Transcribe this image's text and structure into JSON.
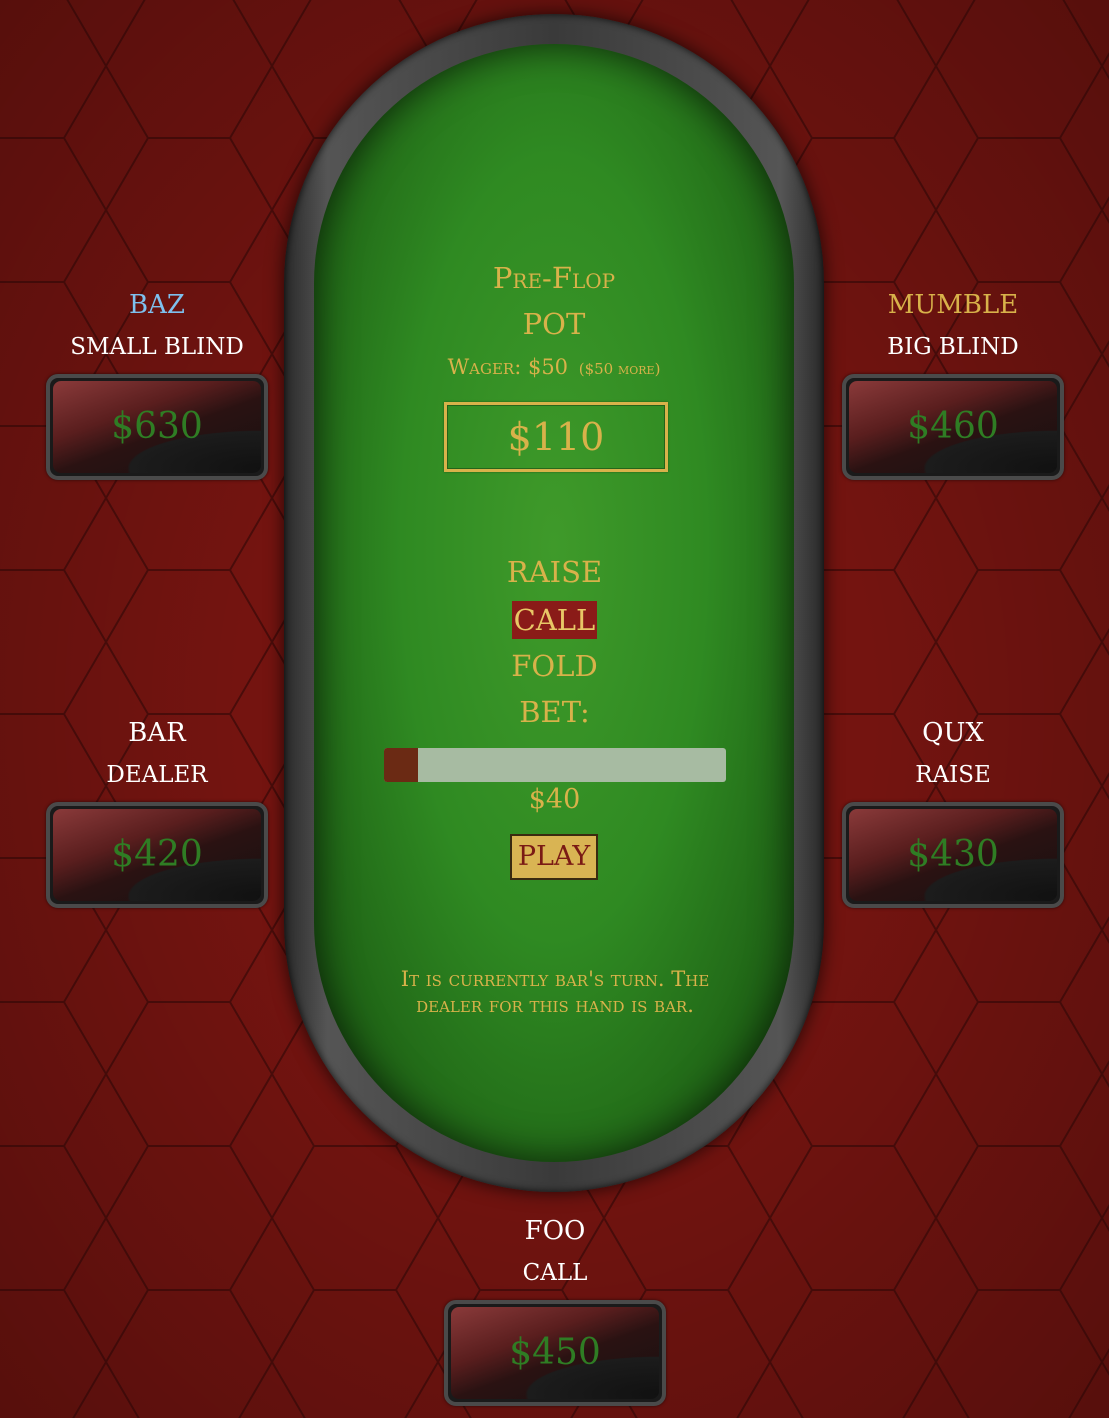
{
  "table": {
    "round": "Pre-Flop",
    "pot_label": "POT",
    "wager_label": "Wager: $50",
    "wager_more": "($50 more)",
    "pot_amount": "$110"
  },
  "actions": {
    "raise": "RAISE",
    "call": "CALL",
    "fold": "FOLD",
    "bet_label": "BET:",
    "selected": "call"
  },
  "bet": {
    "fraction": 0.1,
    "value": "$40"
  },
  "play_label": "PLAY",
  "status": "It is currently bar's turn. The dealer for this hand is bar.",
  "players": {
    "baz": {
      "name": "BAZ",
      "role": "SMALL BLIND",
      "chips": "$630",
      "name_color": "#7ec0ee"
    },
    "mumble": {
      "name": "MUMBLE",
      "role": "BIG BLIND",
      "chips": "$460",
      "name_color": "#d8b24a"
    },
    "bar": {
      "name": "BAR",
      "role": "DEALER",
      "chips": "$420",
      "name_color": "#ffffff"
    },
    "qux": {
      "name": "QUX",
      "role": "RAISE",
      "chips": "$430",
      "name_color": "#ffffff"
    },
    "foo": {
      "name": "FOO",
      "role": "CALL",
      "chips": "$450",
      "name_color": "#ffffff"
    }
  },
  "colors": {
    "background": "#741410",
    "felt": "#2f8a22",
    "gold": "#d8b24a",
    "chip_text": "#2f7d24",
    "selected_action": "#8a1b18"
  }
}
